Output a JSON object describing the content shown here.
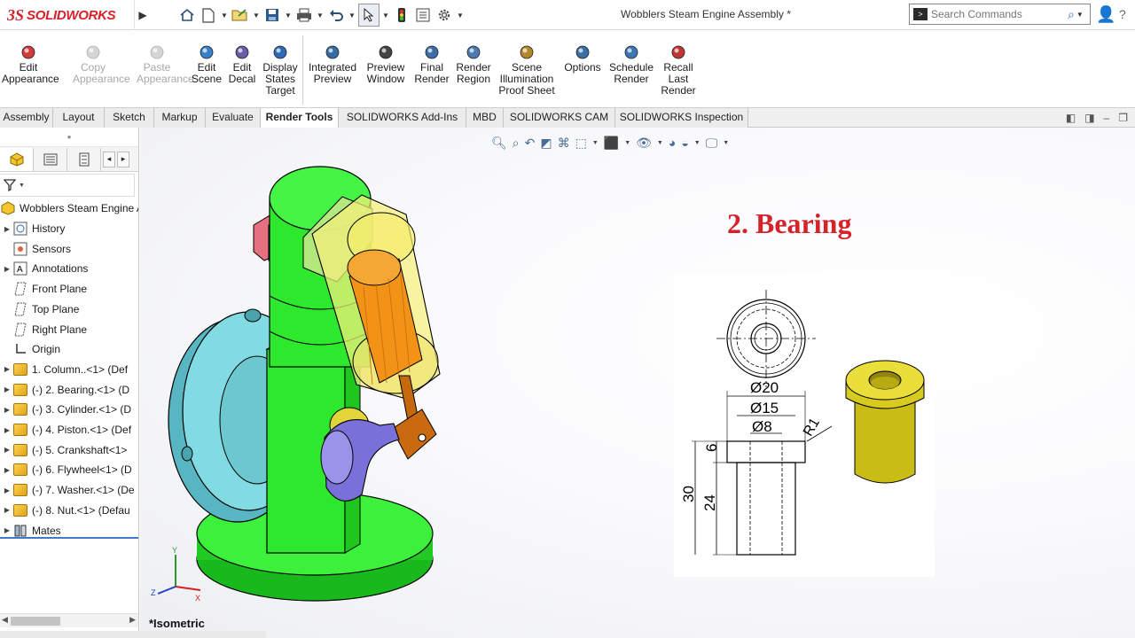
{
  "app": {
    "logo_ds": "3S",
    "logo_name": "SOLIDWORKS",
    "document_title": "Wobblers Steam Engine Assembly *",
    "search_placeholder": "Search Commands"
  },
  "quick_access": [
    "home-icon",
    "new-document-icon",
    "open-icon",
    "save-icon",
    "print-icon",
    "undo-icon",
    "select-icon",
    "rebuild-icon",
    "file-properties-icon",
    "options-icon"
  ],
  "ribbon": {
    "buttons": [
      {
        "label": "Edit\nAppearance",
        "icon": "edit-appearance-icon",
        "enabled": true
      },
      {
        "label": "Copy\nAppearance",
        "icon": "copy-appearance-icon",
        "enabled": false
      },
      {
        "label": "Paste\nAppearance",
        "icon": "paste-appearance-icon",
        "enabled": false
      },
      {
        "label": "Edit\nScene",
        "icon": "edit-scene-icon",
        "enabled": true
      },
      {
        "label": "Edit\nDecal",
        "icon": "edit-decal-icon",
        "enabled": true
      },
      {
        "label": "Display\nStates\nTarget",
        "icon": "display-states-icon",
        "enabled": true
      },
      {
        "label": "Integrated\nPreview",
        "icon": "integrated-preview-icon",
        "enabled": true
      },
      {
        "label": "Preview\nWindow",
        "icon": "preview-window-icon",
        "enabled": true
      },
      {
        "label": "Final\nRender",
        "icon": "final-render-icon",
        "enabled": true
      },
      {
        "label": "Render\nRegion",
        "icon": "render-region-icon",
        "enabled": true
      },
      {
        "label": "Scene\nIllumination\nProof Sheet",
        "icon": "scene-illumination-icon",
        "enabled": true
      },
      {
        "label": "Options",
        "icon": "options-icon",
        "enabled": true
      },
      {
        "label": "Schedule\nRender",
        "icon": "schedule-render-icon",
        "enabled": true
      },
      {
        "label": "Recall\nLast\nRender",
        "icon": "recall-render-icon",
        "enabled": true
      }
    ]
  },
  "tabs": [
    "Assembly",
    "Layout",
    "Sketch",
    "Markup",
    "Evaluate",
    "Render Tools",
    "SOLIDWORKS Add-Ins",
    "MBD",
    "SOLIDWORKS CAM",
    "SOLIDWORKS Inspection"
  ],
  "active_tab": "Render Tools",
  "tree": {
    "root": "Wobblers Steam Engine A",
    "items": [
      {
        "label": "History",
        "expandable": true,
        "icon": "history-icon"
      },
      {
        "label": "Sensors",
        "expandable": false,
        "icon": "sensors-icon"
      },
      {
        "label": "Annotations",
        "expandable": true,
        "icon": "annotations-icon"
      },
      {
        "label": "Front Plane",
        "expandable": false,
        "icon": "plane-icon"
      },
      {
        "label": "Top Plane",
        "expandable": false,
        "icon": "plane-icon"
      },
      {
        "label": "Right Plane",
        "expandable": false,
        "icon": "plane-icon"
      },
      {
        "label": "Origin",
        "expandable": false,
        "icon": "origin-icon"
      },
      {
        "label": "1. Column..<1> (Def",
        "expandable": true,
        "icon": "part-icon"
      },
      {
        "label": "(-) 2. Bearing.<1> (D",
        "expandable": true,
        "icon": "part-icon"
      },
      {
        "label": "(-) 3. Cylinder.<1> (D",
        "expandable": true,
        "icon": "part-icon"
      },
      {
        "label": "(-) 4. Piston.<1> (Def",
        "expandable": true,
        "icon": "part-icon"
      },
      {
        "label": "(-) 5. Crankshaft<1>",
        "expandable": true,
        "icon": "part-icon"
      },
      {
        "label": "(-) 6. Flywheel<1> (D",
        "expandable": true,
        "icon": "part-icon"
      },
      {
        "label": "(-) 7. Washer.<1> (De",
        "expandable": true,
        "icon": "part-icon"
      },
      {
        "label": "(-) 8. Nut.<1> (Defau",
        "expandable": true,
        "icon": "part-icon"
      },
      {
        "label": "Mates",
        "expandable": true,
        "icon": "mates-icon"
      }
    ]
  },
  "viewport": {
    "heading": "2. Bearing",
    "view_label": "*Isometric",
    "triad_labels": {
      "y": "Y",
      "x": "X",
      "z": "Z"
    },
    "drawing": {
      "dims": {
        "d20": "Ø20",
        "d15": "Ø15",
        "d8": "Ø8",
        "r1": "R1",
        "h6": "6",
        "h24": "24",
        "h30": "30"
      }
    }
  },
  "colors": {
    "brand_red": "#d62028",
    "heading_red": "#d3242b",
    "column_green": "#2fe62f",
    "flywheel_cyan": "#7fd9e0",
    "cylinder_yellow": "#f6f089",
    "piston_orange": "#f08a12",
    "crank_blue": "#7a70d9",
    "bearing_olive": "#cfc21a"
  }
}
